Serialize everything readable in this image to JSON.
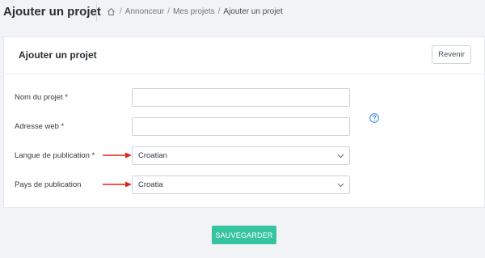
{
  "header": {
    "title": "Ajouter un projet",
    "breadcrumb": {
      "home_icon": "home-icon",
      "items": [
        "Annonceur",
        "Mes projets",
        "Ajouter un projet"
      ],
      "separator": "/"
    }
  },
  "card": {
    "title": "Ajouter un projet",
    "back_label": "Revenir"
  },
  "form": {
    "name": {
      "label": "Nom du projet *",
      "value": ""
    },
    "web": {
      "label": "Adresse web *",
      "value": ""
    },
    "language": {
      "label": "Langue de publication *",
      "value": "Croatian",
      "help_icon": "question-circle-icon"
    },
    "country": {
      "label": "Pays de publication",
      "value": "Croatia"
    }
  },
  "actions": {
    "save_label": "SAUVEGARDER"
  },
  "colors": {
    "accent": "#35c3a0",
    "annotation_arrow": "#e0241b",
    "help_icon": "#3d8ef0"
  }
}
